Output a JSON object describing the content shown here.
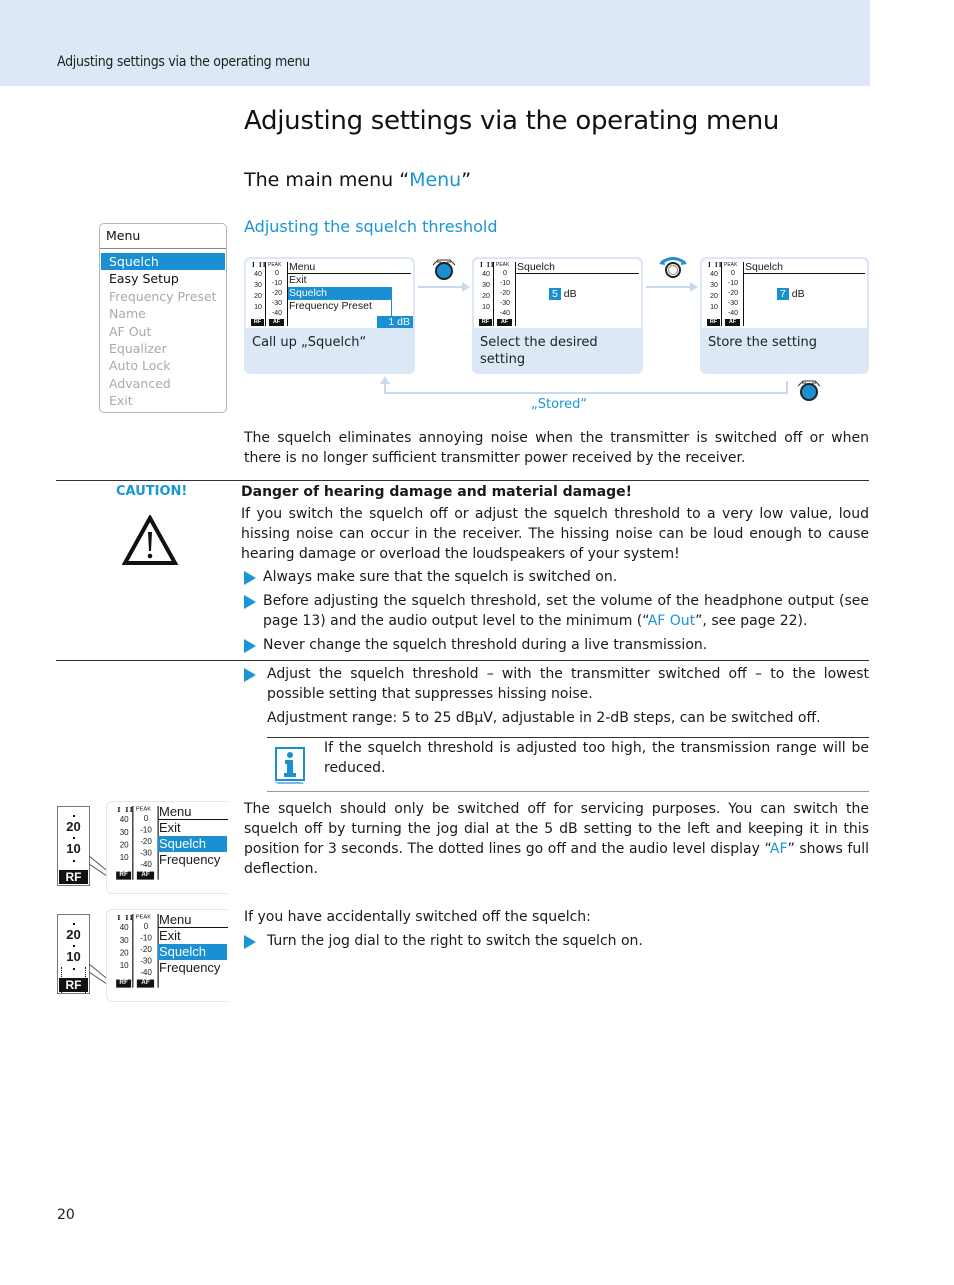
{
  "header": {
    "running_title": "Adjusting settings via the operating menu"
  },
  "page_title": "Adjusting settings via the operating menu",
  "section": {
    "prefix": "The main menu “",
    "highlight": "Menu",
    "suffix": "”"
  },
  "subsection_title": "Adjusting the squelch threshold",
  "main_menu": {
    "title": "Menu",
    "items": [
      {
        "label": "Squelch",
        "state": "selected"
      },
      {
        "label": "Easy Setup",
        "state": "active"
      },
      {
        "label": "Frequency Preset",
        "state": "inactive"
      },
      {
        "label": "Name",
        "state": "inactive"
      },
      {
        "label": "AF Out",
        "state": "inactive"
      },
      {
        "label": "Equalizer",
        "state": "inactive"
      },
      {
        "label": "Auto Lock",
        "state": "inactive"
      },
      {
        "label": "Advanced",
        "state": "inactive"
      },
      {
        "label": "Exit",
        "state": "inactive"
      }
    ]
  },
  "meters": {
    "rf_header": "I II",
    "af_header": "PEAK",
    "rf_scale": [
      "40",
      "30",
      "20",
      "10"
    ],
    "af_scale": [
      "0",
      "-10",
      "-20",
      "-30",
      "-40"
    ],
    "rf_label": "RF",
    "af_label": "AF"
  },
  "steps": [
    {
      "lcd_title": "Menu",
      "lcd_rows": [
        "Exit",
        "Squelch",
        "Frequency Preset"
      ],
      "lcd_selected": "Squelch",
      "lcd_value": "1 dB",
      "label": "Call up „Squelch“"
    },
    {
      "lcd_title": "Squelch",
      "value_num": "5",
      "value_unit": "dB",
      "label": "Select the desired setting",
      "control_icon": "jog-dial-press"
    },
    {
      "lcd_title": "Squelch",
      "value_num": "7",
      "value_unit": "dB",
      "label": "Store the setting",
      "control_icon": "jog-dial-turn"
    }
  ],
  "return_label": "„Stored“",
  "intro_text": "The squelch eliminates annoying noise when the transmitter is switched off or when there is no longer sufficient transmitter power received by the receiver.",
  "caution": {
    "label": "CAUTION!",
    "heading": "Danger of hearing damage and material damage!",
    "text": "If you switch the squelch off or adjust the squelch threshold to a very low value, loud hissing noise can occur in the receiver. The hissing noise can be loud enough to cause hearing damage or overload the loudspeakers of your system!",
    "bullets": [
      {
        "text": "Always make sure that the squelch is switched on."
      },
      {
        "pre": "Before adjusting the squelch threshold, set the volume of the headphone output (see page 13) and the audio output level to the minimum (“",
        "link": "AF Out",
        "post": "”, see page 22)."
      },
      {
        "text": "Never change the squelch threshold during a live transmission."
      }
    ]
  },
  "instruction": {
    "bullet": "Adjust the squelch threshold – with the transmitter switched off – to the lowest possible setting that suppresses hissing noise.",
    "range": "Adjustment range: 5 to 25 dBµV, adjustable in 2-dB steps, can be switched off."
  },
  "note": "If the squelch threshold is adjusted too high, the transmission range will be reduced.",
  "switch_off": {
    "pre": "The squelch should only be switched off for servicing purposes. You can switch the squelch off by turning the jog dial at the 5 dB setting to the left and keeping it in this position for 3 seconds. The dotted lines go off and the audio level display “",
    "link": "AF",
    "post": "” shows full deflection."
  },
  "switch_on": {
    "intro": "If you have accidentally switched off the squelch:",
    "bullet": "Turn the jog dial to the right to switch the squelch on."
  },
  "mini_display": {
    "zoom_values": [
      "20",
      "10"
    ],
    "zoom_label": "RF",
    "lcd_title": "Menu",
    "lcd_rows": [
      "Exit",
      "Squelch",
      "Frequency"
    ]
  },
  "page_number": "20"
}
